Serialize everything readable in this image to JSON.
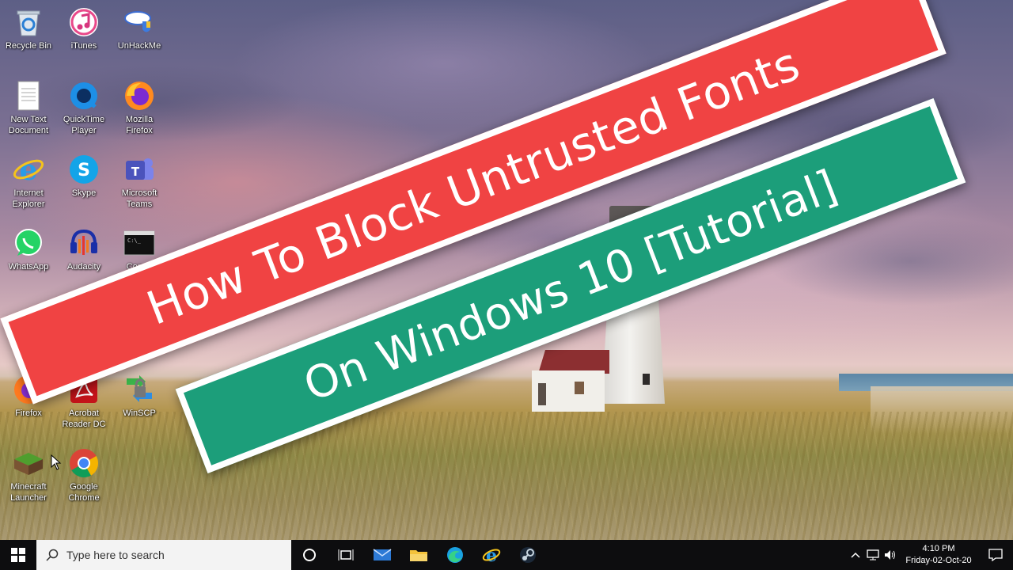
{
  "desktop": {
    "icons": [
      {
        "label": "Recycle Bin",
        "icon": "recycle-bin-icon"
      },
      {
        "label": "iTunes",
        "icon": "itunes-icon"
      },
      {
        "label": "UnHackMe",
        "icon": "unhackme-icon"
      },
      {
        "label": "New Text\nDocument",
        "icon": "text-document-icon"
      },
      {
        "label": "QuickTime\nPlayer",
        "icon": "quicktime-icon"
      },
      {
        "label": "Mozilla\nFirefox",
        "icon": "firefox-icon"
      },
      {
        "label": "Internet\nExplorer",
        "icon": "internet-explorer-icon"
      },
      {
        "label": "Skype",
        "icon": "skype-icon"
      },
      {
        "label": "Microsoft\nTeams",
        "icon": "teams-icon"
      },
      {
        "label": "WhatsApp",
        "icon": "whatsapp-icon"
      },
      {
        "label": "Audacity",
        "icon": "audacity-icon"
      },
      {
        "label": "Comm",
        "icon": "command-prompt-icon"
      },
      {
        "label": "Firefox",
        "icon": "firefox-icon"
      },
      {
        "label": "Acrobat\nReader DC",
        "icon": "acrobat-icon"
      },
      {
        "label": "WinSCP",
        "icon": "winscp-icon"
      },
      {
        "label": "Minecraft\nLauncher",
        "icon": "minecraft-icon"
      },
      {
        "label": "Google\nChrome",
        "icon": "chrome-icon"
      }
    ]
  },
  "banner": {
    "line1": "How To Block Untrusted Fonts",
    "line2": "On Windows 10 [Tutorial]",
    "colors": {
      "red": "#f04343",
      "green": "#1c9e7a"
    }
  },
  "taskbar": {
    "search_placeholder": "Type here to search",
    "pinned": [
      "task-view-icon",
      "mail-icon",
      "file-explorer-icon",
      "edge-icon",
      "internet-explorer-icon",
      "steam-icon"
    ],
    "clock": {
      "time": "4:10 PM",
      "date": "Friday-02-Oct-20"
    }
  }
}
